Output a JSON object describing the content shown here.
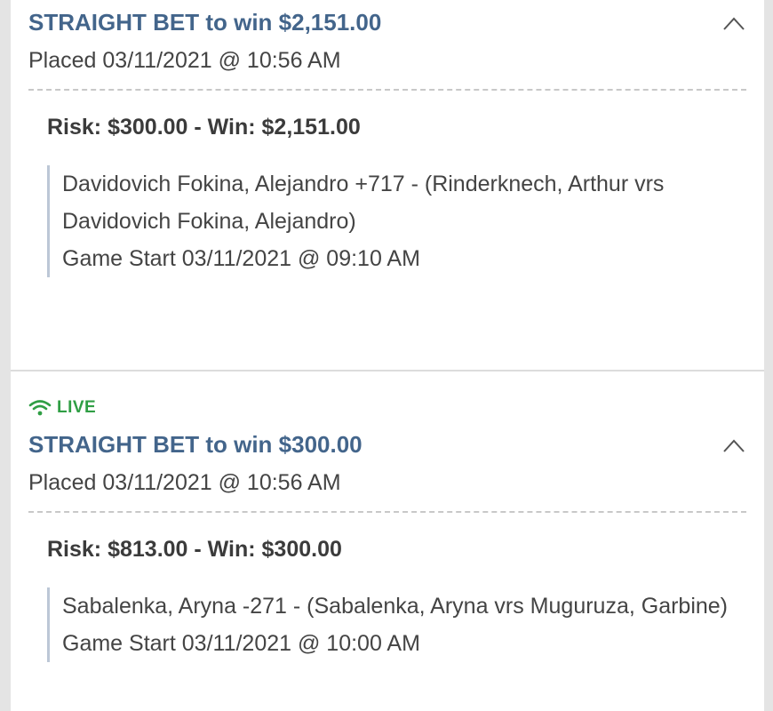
{
  "bets": [
    {
      "live": "",
      "title": "STRAIGHT BET to win $2,151.00",
      "placed": "Placed 03/11/2021 @ 10:56 AM",
      "risk_win": "Risk: $300.00 - Win: $2,151.00",
      "selection": "Davidovich Fokina, Alejandro +717 - (Rinderknech, Arthur vrs Davidovich Fokina, Alejandro)",
      "game_start": "Game Start 03/11/2021 @ 09:10 AM"
    },
    {
      "live": "LIVE",
      "title": "STRAIGHT BET to win $300.00",
      "placed": "Placed 03/11/2021 @ 10:56 AM",
      "risk_win": "Risk: $813.00 - Win: $300.00",
      "selection": "Sabalenka, Aryna -271 - (Sabalenka, Aryna vrs Muguruza, Garbine)",
      "game_start": "Game Start 03/11/2021 @ 10:00 AM"
    }
  ],
  "icons": {
    "collapse": "chevron-up-icon",
    "live": "wifi-signal-icon"
  },
  "colors": {
    "title": "#43658b",
    "live": "#2f9e44",
    "detail_border": "#bcc7d6"
  }
}
